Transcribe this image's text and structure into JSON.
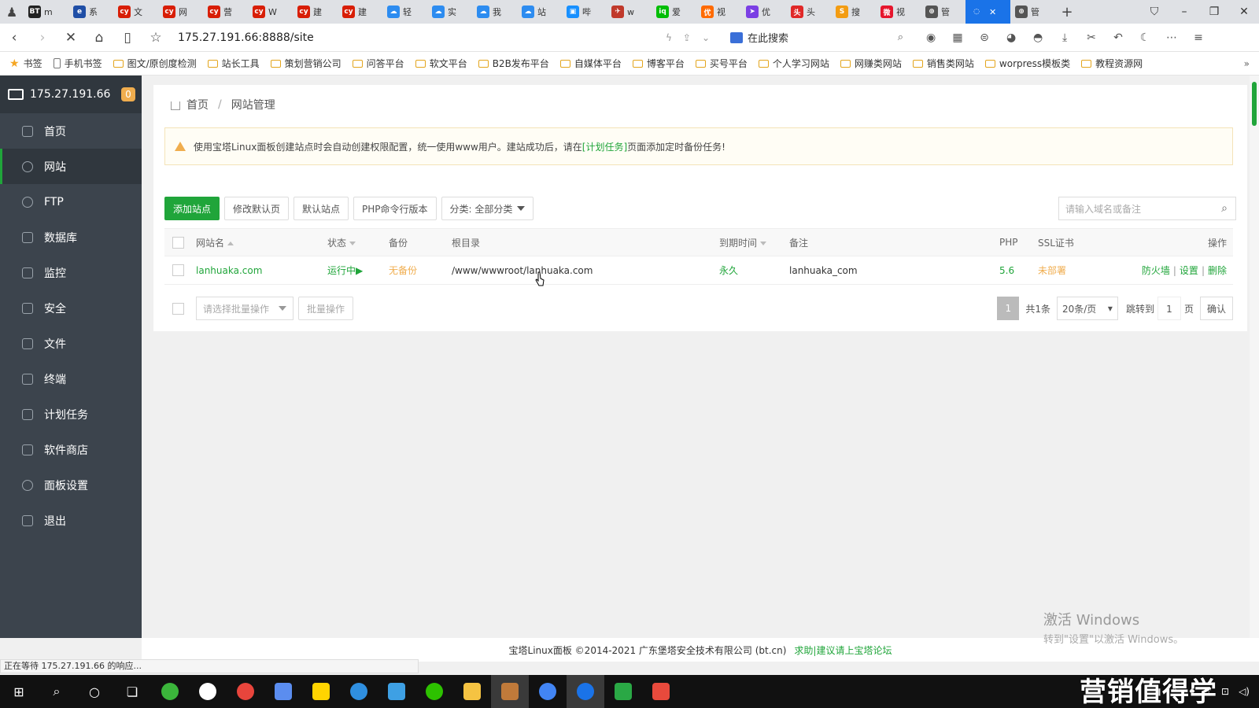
{
  "browser": {
    "tabs": [
      {
        "icon": "bt-icon",
        "label": "m",
        "color": "#222222",
        "glyph": "BT"
      },
      {
        "icon": "edge-icon",
        "label": "系",
        "color": "#1f4ea6",
        "glyph": "e"
      },
      {
        "icon": "cy-icon",
        "label": "文",
        "color": "#d81e06",
        "glyph": "cy"
      },
      {
        "icon": "cy-icon",
        "label": "网",
        "color": "#d81e06",
        "glyph": "cy"
      },
      {
        "icon": "cy-icon",
        "label": "营",
        "color": "#d81e06",
        "glyph": "cy"
      },
      {
        "icon": "cy-icon",
        "label": "W",
        "color": "#d81e06",
        "glyph": "cy"
      },
      {
        "icon": "cy-icon",
        "label": "建",
        "color": "#d81e06",
        "glyph": "cy"
      },
      {
        "icon": "cy-icon",
        "label": "建",
        "color": "#d81e06",
        "glyph": "cy"
      },
      {
        "icon": "cloud-icon",
        "label": "轻",
        "color": "#2d8cf0",
        "glyph": "☁"
      },
      {
        "icon": "cloud-icon",
        "label": "实",
        "color": "#2d8cf0",
        "glyph": "☁"
      },
      {
        "icon": "cloud-icon",
        "label": "我",
        "color": "#2d8cf0",
        "glyph": "☁"
      },
      {
        "icon": "cloud-icon",
        "label": "站",
        "color": "#2d8cf0",
        "glyph": "☁"
      },
      {
        "icon": "tv-icon",
        "label": "哔",
        "color": "#1890ff",
        "glyph": "▣"
      },
      {
        "icon": "bird-icon",
        "label": "w",
        "color": "#c0392b",
        "glyph": "✈"
      },
      {
        "icon": "iqiyi-icon",
        "label": "爱",
        "color": "#00be06",
        "glyph": "iq"
      },
      {
        "icon": "youku-icon",
        "label": "视",
        "color": "#ff6a00",
        "glyph": "优"
      },
      {
        "icon": "arrow-icon",
        "label": "优",
        "color": "#7b3fe4",
        "glyph": "➤"
      },
      {
        "icon": "toutiao-icon",
        "label": "头",
        "color": "#e02828",
        "glyph": "头"
      },
      {
        "icon": "sogou-icon",
        "label": "搜",
        "color": "#f39c12",
        "glyph": "S"
      },
      {
        "icon": "weibo-icon",
        "label": "视",
        "color": "#e6162d",
        "glyph": "微"
      },
      {
        "icon": "globe-icon",
        "label": "管",
        "color": "#555555",
        "glyph": "⊕"
      },
      {
        "icon": "loading-icon",
        "label": "",
        "color": "#ffffff",
        "glyph": "◌",
        "active": true
      },
      {
        "icon": "globe-icon",
        "label": "管",
        "color": "#555555",
        "glyph": "⊕"
      }
    ],
    "url": "175.27.191.66:8888/site",
    "search_placeholder": "在此搜索",
    "bookmarks": [
      {
        "label": "书签",
        "type": "star"
      },
      {
        "label": "手机书签",
        "type": "phone"
      },
      {
        "label": "图文/原创度检测",
        "type": "folder"
      },
      {
        "label": "站长工具",
        "type": "folder"
      },
      {
        "label": "策划营销公司",
        "type": "folder"
      },
      {
        "label": "问答平台",
        "type": "folder"
      },
      {
        "label": "软文平台",
        "type": "folder"
      },
      {
        "label": "B2B发布平台",
        "type": "folder"
      },
      {
        "label": "自媒体平台",
        "type": "folder"
      },
      {
        "label": "博客平台",
        "type": "folder"
      },
      {
        "label": "买号平台",
        "type": "folder"
      },
      {
        "label": "个人学习网站",
        "type": "folder"
      },
      {
        "label": "网赚类网站",
        "type": "folder"
      },
      {
        "label": "销售类网站",
        "type": "folder"
      },
      {
        "label": "worpress模板类",
        "type": "folder"
      },
      {
        "label": "教程资源网",
        "type": "folder"
      }
    ],
    "bookmarks_more": "»",
    "status_text": "正在等待 175.27.191.66 的响应..."
  },
  "panel": {
    "server_ip": "175.27.191.66",
    "badge_count": "0",
    "nav": [
      {
        "label": "首页",
        "icon": "home-icon"
      },
      {
        "label": "网站",
        "icon": "globe-icon",
        "active": true
      },
      {
        "label": "FTP",
        "icon": "ftp-icon"
      },
      {
        "label": "数据库",
        "icon": "database-icon"
      },
      {
        "label": "监控",
        "icon": "monitor-icon"
      },
      {
        "label": "安全",
        "icon": "shield-icon"
      },
      {
        "label": "文件",
        "icon": "folder-icon"
      },
      {
        "label": "终端",
        "icon": "terminal-icon"
      },
      {
        "label": "计划任务",
        "icon": "calendar-icon"
      },
      {
        "label": "软件商店",
        "icon": "grid-icon"
      },
      {
        "label": "面板设置",
        "icon": "gear-icon"
      },
      {
        "label": "退出",
        "icon": "logout-icon"
      }
    ],
    "breadcrumb": {
      "home": "首页",
      "current": "网站管理"
    },
    "alert": {
      "text_before": "使用宝塔Linux面板创建站点时会自动创建权限配置，统一使用www用户。建站成功后，请在",
      "link": "[计划任务]",
      "text_after": "页面添加定时备份任务!"
    },
    "toolbar": {
      "add_site": "添加站点",
      "edit_default": "修改默认页",
      "default_site": "默认站点",
      "php_cli": "PHP命令行版本",
      "category": "分类: 全部分类"
    },
    "search_placeholder": "请输入域名或备注",
    "table": {
      "headers": {
        "name": "网站名",
        "status": "状态",
        "backup": "备份",
        "root": "根目录",
        "expire": "到期时间",
        "note": "备注",
        "php": "PHP",
        "ssl": "SSL证书",
        "ops": "操作"
      },
      "rows": [
        {
          "name": "lanhuaka.com",
          "status": "运行中▶",
          "backup": "无备份",
          "root": "/www/wwwroot/lanhuaka.com",
          "expire": "永久",
          "note": "lanhuaka_com",
          "php": "5.6",
          "ssl": "未部署",
          "op_firewall": "防火墙",
          "op_settings": "设置",
          "op_delete": "删除"
        }
      ]
    },
    "batch": {
      "select_placeholder": "请选择批量操作",
      "button": "批量操作"
    },
    "pager": {
      "current": "1",
      "total": "共1条",
      "per_page": "20条/页",
      "jump_label": "跳转到",
      "jump_value": "1",
      "page_unit": "页",
      "confirm": "确认"
    },
    "footer": {
      "copyright": "宝塔Linux面板 ©2014-2021 广东堡塔安全技术有限公司 (bt.cn)",
      "link": "求助|建议请上宝塔论坛"
    }
  },
  "watermark": {
    "title": "激活 Windows",
    "subtitle": "转到\"设置\"以激活 Windows。"
  },
  "overlay_brand": "营销值得学",
  "colors": {
    "accent": "#20a53a",
    "sidebar": "#3c444d",
    "warning": "#f0ad4e"
  }
}
